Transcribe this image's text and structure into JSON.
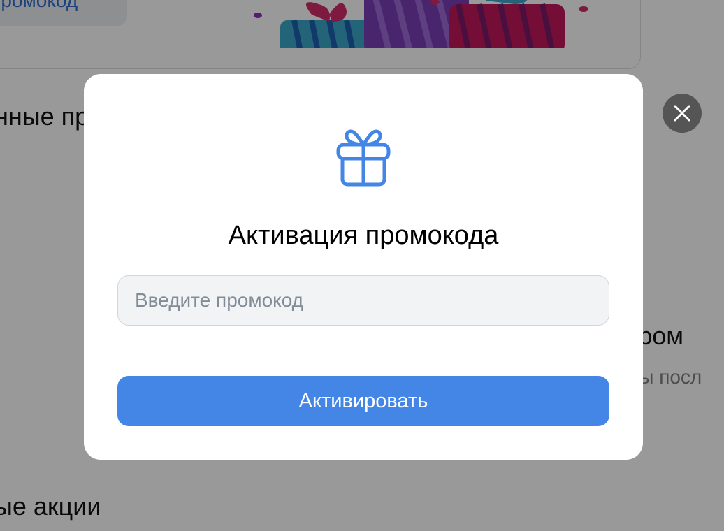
{
  "background": {
    "promo_link_label": "ть промокод",
    "section_heading_1": "нные пр",
    "section_heading_2": "к пром",
    "section_sub_2": "оды посл",
    "section_heading_3": "ые акции"
  },
  "modal": {
    "icon": "gift-icon",
    "title": "Активация промокода",
    "input_placeholder": "Введите промокод",
    "input_value": "",
    "activate_label": "Активировать",
    "close_icon": "close-icon"
  },
  "colors": {
    "accent": "#4486e6",
    "link": "#2f6fd1",
    "input_bg": "#f2f3f5",
    "overlay": "rgba(0,0,0,0.40)"
  }
}
